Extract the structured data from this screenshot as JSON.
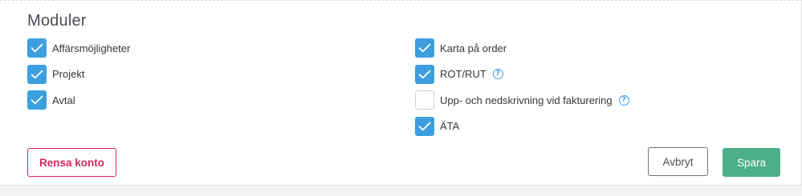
{
  "section": {
    "title": "Moduler"
  },
  "modules_left": [
    {
      "label": "Affärsmöjligheter",
      "checked": true
    },
    {
      "label": "Projekt",
      "checked": true
    },
    {
      "label": "Avtal",
      "checked": true
    }
  ],
  "modules_right": [
    {
      "label": "Karta på order",
      "checked": true,
      "help": false
    },
    {
      "label": "ROT/RUT",
      "checked": true,
      "help": true
    },
    {
      "label": "Upp- och nedskrivning vid fakturering",
      "checked": false,
      "help": true
    },
    {
      "label": "ÄTA",
      "checked": true,
      "help": false
    }
  ],
  "help_glyph": "?",
  "actions": {
    "clear_label": "Rensa konto",
    "cancel_label": "Avbryt",
    "save_label": "Spara"
  },
  "colors": {
    "checkbox_checked": "#3d9fe0",
    "danger": "#d2275e",
    "primary": "#4caf88"
  }
}
